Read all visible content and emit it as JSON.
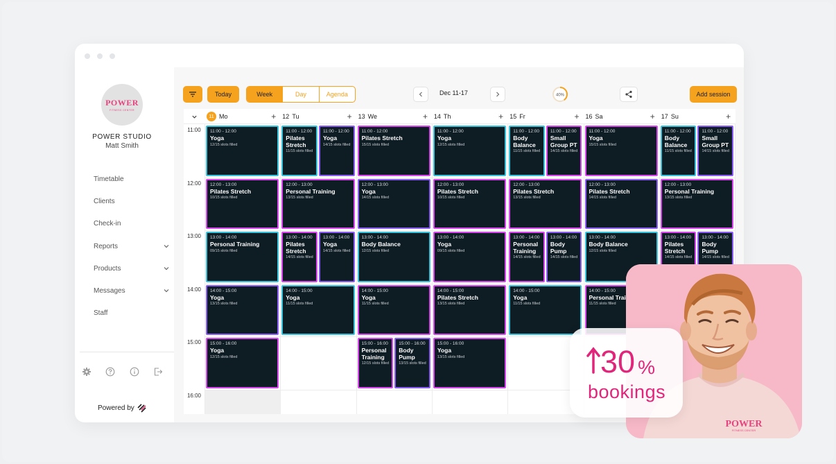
{
  "brand": {
    "avatar_logo": "POWER",
    "avatar_logo_sub": "FITNESS CENTER",
    "studio_name": "POWER STUDIO",
    "user_name": "Matt Smith",
    "powered_by": "Powered by",
    "accent_color": "#f5a21f",
    "brand_pink": "#e6447e"
  },
  "sidebar": {
    "items": [
      {
        "label": "Timetable",
        "expandable": false
      },
      {
        "label": "Clients",
        "expandable": false
      },
      {
        "label": "Check-in",
        "expandable": false
      },
      {
        "label": "Reports",
        "expandable": true
      },
      {
        "label": "Products",
        "expandable": true
      },
      {
        "label": "Messages",
        "expandable": true
      },
      {
        "label": "Staff",
        "expandable": false
      }
    ],
    "footer_icons": [
      "gear-icon",
      "help-icon",
      "info-icon",
      "logout-icon"
    ]
  },
  "toolbar": {
    "today_label": "Today",
    "views": [
      "Week",
      "Day",
      "Agenda"
    ],
    "active_view": "Week",
    "date_range": "Dec 11-17",
    "progress_label": "40%",
    "progress_value": 0.4,
    "add_session_label": "Add session"
  },
  "calendar": {
    "days": [
      {
        "num": "11",
        "name": "Mo",
        "today": true
      },
      {
        "num": "12",
        "name": "Tu",
        "today": false
      },
      {
        "num": "13",
        "name": "We",
        "today": false
      },
      {
        "num": "14",
        "name": "Th",
        "today": false
      },
      {
        "num": "15",
        "name": "Fr",
        "today": false
      },
      {
        "num": "16",
        "name": "Sa",
        "today": false
      },
      {
        "num": "17",
        "name": "Su",
        "today": false
      }
    ],
    "times": [
      "11:00",
      "12:00",
      "13:00",
      "14:00",
      "15:00",
      "16:00"
    ],
    "events": [
      {
        "day": 0,
        "row": 0,
        "col": 0,
        "cols": 1,
        "time": "11:00 - 12:00",
        "name": "Yoga",
        "slots": "12/15 slots filled",
        "color": "#37c3dc"
      },
      {
        "day": 1,
        "row": 0,
        "col": 0,
        "cols": 2,
        "time": "11:00 - 12:00",
        "name": "Pilates Stretch",
        "slots": "11/15 slots filled",
        "color": "#37c3dc"
      },
      {
        "day": 1,
        "row": 0,
        "col": 1,
        "cols": 2,
        "time": "11:00 - 12:00",
        "name": "Yoga",
        "slots": "14/15 slots filled",
        "color": "#8b5cf6"
      },
      {
        "day": 2,
        "row": 0,
        "col": 0,
        "cols": 1,
        "time": "11:00 - 12:00",
        "name": "Pilates Stretch",
        "slots": "15/15 slots filled",
        "color": "#d946ef"
      },
      {
        "day": 3,
        "row": 0,
        "col": 0,
        "cols": 1,
        "time": "11:00 - 12:00",
        "name": "Yoga",
        "slots": "12/15 slots filled",
        "color": "#37c3dc"
      },
      {
        "day": 4,
        "row": 0,
        "col": 0,
        "cols": 2,
        "time": "11:00 - 12:00",
        "name": "Body Balance",
        "slots": "11/15 slots filled",
        "color": "#37c3dc"
      },
      {
        "day": 4,
        "row": 0,
        "col": 1,
        "cols": 2,
        "time": "11:00 - 12:00",
        "name": "Small Group PT",
        "slots": "14/15 slots filled",
        "color": "#d946ef"
      },
      {
        "day": 5,
        "row": 0,
        "col": 0,
        "cols": 1,
        "time": "11:00 - 12:00",
        "name": "Yoga",
        "slots": "15/15 slots filled",
        "color": "#d946ef"
      },
      {
        "day": 6,
        "row": 0,
        "col": 0,
        "cols": 2,
        "time": "11:00 - 12:00",
        "name": "Body Balance",
        "slots": "11/15 slots filled",
        "color": "#37c3dc"
      },
      {
        "day": 6,
        "row": 0,
        "col": 1,
        "cols": 2,
        "time": "11:00 - 12:00",
        "name": "Small Group PT",
        "slots": "14/15 slots filled",
        "color": "#8b5cf6"
      },
      {
        "day": 0,
        "row": 1,
        "col": 0,
        "cols": 1,
        "time": "12:00 - 13:00",
        "name": "Pilates Stretch",
        "slots": "10/15 slots filled",
        "color": "#d946ef"
      },
      {
        "day": 1,
        "row": 1,
        "col": 0,
        "cols": 1,
        "time": "12:00 - 13:00",
        "name": "Personal Training",
        "slots": "13/15 slots filled",
        "color": "#d946ef"
      },
      {
        "day": 2,
        "row": 1,
        "col": 0,
        "cols": 1,
        "time": "12:00 - 13:00",
        "name": "Yoga",
        "slots": "14/15 slots filled",
        "color": "#8b5cf6"
      },
      {
        "day": 3,
        "row": 1,
        "col": 0,
        "cols": 1,
        "time": "12:00 - 13:00",
        "name": "Pilates Stretch",
        "slots": "10/15 slots filled",
        "color": "#d946ef"
      },
      {
        "day": 4,
        "row": 1,
        "col": 0,
        "cols": 1,
        "time": "12:00 - 13:00",
        "name": "Pilates Stretch",
        "slots": "13/15 slots filled",
        "color": "#d946ef"
      },
      {
        "day": 5,
        "row": 1,
        "col": 0,
        "cols": 1,
        "time": "12:00 - 13:00",
        "name": "Pilates Stretch",
        "slots": "14/15 slots filled",
        "color": "#8b5cf6"
      },
      {
        "day": 6,
        "row": 1,
        "col": 0,
        "cols": 1,
        "time": "12:00 - 13:00",
        "name": "Personal Training",
        "slots": "13/15 slots filled",
        "color": "#d946ef"
      },
      {
        "day": 0,
        "row": 2,
        "col": 0,
        "cols": 1,
        "time": "13:00 - 14:00",
        "name": "Personal Training",
        "slots": "09/15 slots filled",
        "color": "#37c3dc"
      },
      {
        "day": 1,
        "row": 2,
        "col": 0,
        "cols": 2,
        "time": "13:00 - 14:00",
        "name": "Pilates Stretch",
        "slots": "14/15 slots filled",
        "color": "#d946ef"
      },
      {
        "day": 1,
        "row": 2,
        "col": 1,
        "cols": 2,
        "time": "13:00 - 14:00",
        "name": "Yoga",
        "slots": "14/15 slots filled",
        "color": "#8b5cf6"
      },
      {
        "day": 2,
        "row": 2,
        "col": 0,
        "cols": 1,
        "time": "13:00 - 14:00",
        "name": "Body Balance",
        "slots": "12/15 slots filled",
        "color": "#37c3dc"
      },
      {
        "day": 3,
        "row": 2,
        "col": 0,
        "cols": 1,
        "time": "13:00 - 14:00",
        "name": "Yoga",
        "slots": "09/15 slots filled",
        "color": "#d946ef"
      },
      {
        "day": 4,
        "row": 2,
        "col": 0,
        "cols": 2,
        "time": "13:00 - 14:00",
        "name": "Personal Training",
        "slots": "14/15 slots filled",
        "color": "#d946ef"
      },
      {
        "day": 4,
        "row": 2,
        "col": 1,
        "cols": 2,
        "time": "13:00 - 14:00",
        "name": "Body Pump",
        "slots": "14/15 slots filled",
        "color": "#8b5cf6"
      },
      {
        "day": 5,
        "row": 2,
        "col": 0,
        "cols": 1,
        "time": "13:00 - 14:00",
        "name": "Body Balance",
        "slots": "12/15 slots filled",
        "color": "#37c3dc"
      },
      {
        "day": 6,
        "row": 2,
        "col": 0,
        "cols": 2,
        "time": "13:00 - 14:00",
        "name": "Pilates Stretch",
        "slots": "14/15 slots filled",
        "color": "#d946ef"
      },
      {
        "day": 6,
        "row": 2,
        "col": 1,
        "cols": 2,
        "time": "13:00 - 14:00",
        "name": "Body Pump",
        "slots": "14/15 slots filled",
        "color": "#8b5cf6"
      },
      {
        "day": 0,
        "row": 3,
        "col": 0,
        "cols": 1,
        "time": "14:00 - 15:00",
        "name": "Yoga",
        "slots": "13/15 slots filled",
        "color": "#8b5cf6"
      },
      {
        "day": 1,
        "row": 3,
        "col": 0,
        "cols": 1,
        "time": "14:00 - 15:00",
        "name": "Yoga",
        "slots": "11/15 slots filled",
        "color": "#37c3dc"
      },
      {
        "day": 2,
        "row": 3,
        "col": 0,
        "cols": 1,
        "time": "14:00 - 15:00",
        "name": "Yoga",
        "slots": "11/15 slots filled",
        "color": "#d946ef"
      },
      {
        "day": 3,
        "row": 3,
        "col": 0,
        "cols": 1,
        "time": "14:00 - 15:00",
        "name": "Pilates Stretch",
        "slots": "13/15 slots filled",
        "color": "#d946ef"
      },
      {
        "day": 4,
        "row": 3,
        "col": 0,
        "cols": 1,
        "time": "14:00 - 15:00",
        "name": "Yoga",
        "slots": "11/15 slots filled",
        "color": "#37c3dc"
      },
      {
        "day": 5,
        "row": 3,
        "col": 0,
        "cols": 1,
        "time": "14:00 - 15:00",
        "name": "Personal Training",
        "slots": "11/15 slots filled",
        "color": "#d946ef"
      },
      {
        "day": 0,
        "row": 4,
        "col": 0,
        "cols": 1,
        "time": "15:00 - 16:00",
        "name": "Yoga",
        "slots": "12/15 slots filled",
        "color": "#d946ef"
      },
      {
        "day": 2,
        "row": 4,
        "col": 0,
        "cols": 2,
        "time": "15:00 - 16:00",
        "name": "Personal Training",
        "slots": "12/15 slots filled",
        "color": "#d946ef"
      },
      {
        "day": 2,
        "row": 4,
        "col": 1,
        "cols": 2,
        "time": "15:00 - 16:00",
        "name": "Body Pump",
        "slots": "13/15 slots filled",
        "color": "#8b5cf6"
      },
      {
        "day": 3,
        "row": 4,
        "col": 0,
        "cols": 1,
        "time": "15:00 - 16:00",
        "name": "Yoga",
        "slots": "13/15 slots filled",
        "color": "#d946ef"
      }
    ]
  },
  "promo": {
    "stat_value": "30",
    "stat_unit": "%",
    "stat_label": "bookings",
    "shirt_logo": "POWER",
    "shirt_logo_sub": "FITNESS CENTER",
    "color": "#e0267a"
  }
}
